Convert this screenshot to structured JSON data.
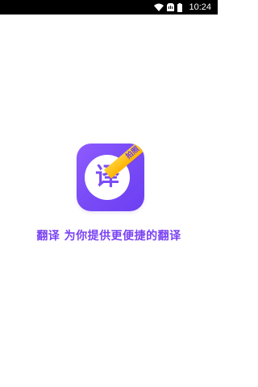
{
  "status_bar": {
    "time": "10:24",
    "icons": [
      "wifi-icon",
      "sim-icon",
      "battery-icon"
    ]
  },
  "app_icon": {
    "character": "译",
    "badge_text": "拍照",
    "colors": {
      "gradient_start": "#8f5bff",
      "gradient_end": "#6c3ff2",
      "badge": "#ffb300",
      "circle": "#ffffff"
    }
  },
  "tagline": "翻译 为你提供更便捷的翻译",
  "colors": {
    "tagline": "#7a42f4",
    "background": "#ffffff",
    "status_bar": "#000000"
  }
}
